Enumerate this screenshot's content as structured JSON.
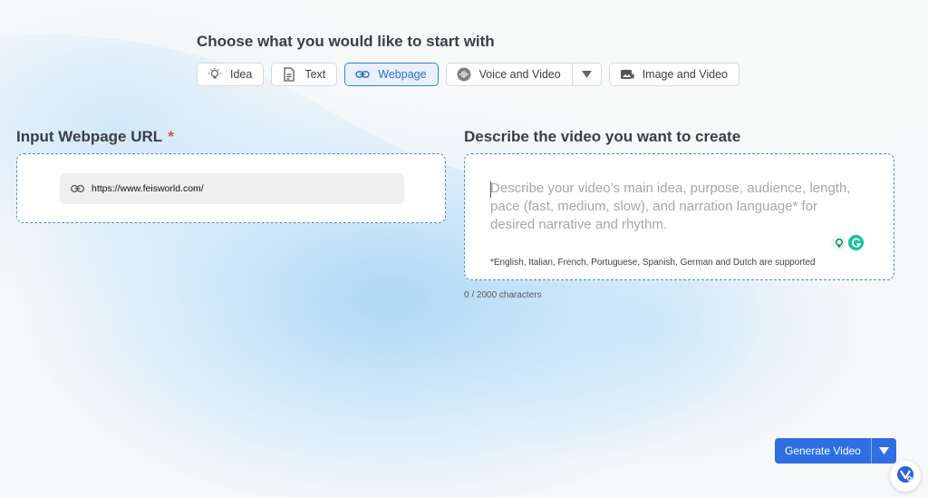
{
  "header": {
    "title": "Choose what you would like to start with",
    "tabs": [
      {
        "label": "Idea",
        "icon": "lightbulb-icon"
      },
      {
        "label": "Text",
        "icon": "document-icon"
      },
      {
        "label": "Webpage",
        "icon": "link-icon",
        "active": true
      },
      {
        "label": "Voice and Video",
        "icon": "sound-wave-icon"
      },
      {
        "label": "Image and Video",
        "icon": "image-video-icon"
      }
    ]
  },
  "url_section": {
    "label": "Input Webpage URL",
    "required_mark": "*",
    "url_value": "https://www.feisworld.com/"
  },
  "describe_section": {
    "label": "Describe the video you want to create",
    "placeholder": "Describe your video’s main idea, purpose, audience, length, pace (fast, medium, slow), and narration language* for desired narrative and rhythm.",
    "language_note": "*English, Italian, French, Portuguese, Spanish, German and Dutch are supported",
    "char_count": "0 / 2000 characters"
  },
  "actions": {
    "generate_label": "Generate Video"
  },
  "colors": {
    "accent": "#2f6fe3",
    "active_tab_bg": "#e8f1fd",
    "required": "#e0513c",
    "grammarly": "#15c39a"
  }
}
